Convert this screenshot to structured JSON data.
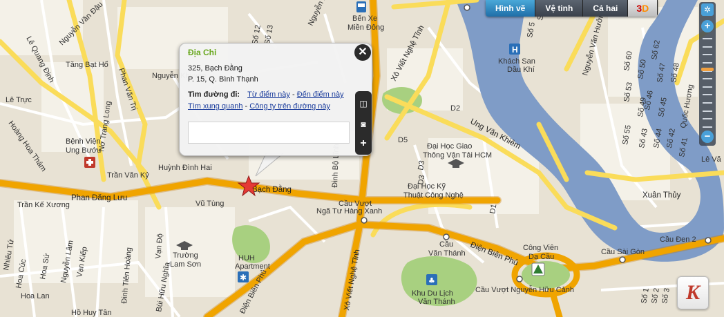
{
  "map_type_tabs": [
    {
      "label": "Hình vẽ",
      "active": true
    },
    {
      "label": "Vệ tinh",
      "active": false
    },
    {
      "label": "Cả hai",
      "active": false
    }
  ],
  "tab_3d": {
    "label_3": "3",
    "label_d": "D"
  },
  "zoom": {
    "plus": "+",
    "minus": "−",
    "level_fraction": 0.35
  },
  "popup": {
    "title": "Địa Chỉ",
    "address_line1": "325, Bạch Đằng",
    "address_line2": "P. 15, Q. Bình Thạnh",
    "directions_label": "Tìm đường đi:",
    "from_here": "Từ điểm này",
    "to_here": "Đến điểm này",
    "nearby": "Tìm xung quanh",
    "companies": "Công ty trên đường này",
    "separator": " - ",
    "close_label": "✕"
  },
  "side_tools": {
    "zoom_in": "+"
  },
  "labels": {
    "nguyen_xi": "Nguyễn Xí",
    "ben_xe_1": "Bến Xe",
    "ben_xe_2": "Miền Đông",
    "xo_viet_nghe_tinh_top": "Xô Viết Nghệ Tĩnh",
    "xo_viet_nghe_tinh_bottom": "Xô Viết Nghệ Tĩnh",
    "khach_san_1": "Khách San",
    "khach_san_2": "Dầu Khí",
    "nguyen_van_huong": "Nguyễn Văn Hưởng",
    "le_quang_dinh": "Lê Quang Định",
    "nguyen_van_dau": "Nguyễn Văn Đậu",
    "tang_bat_ho": "Tăng Bạt Hổ",
    "no_trang_long": "Nơ Trang Long",
    "phan_van_tri": "Phan Văn Trị",
    "nguyen_khuyen": "Nguyễn Khuyến",
    "le_truc": "Lê Trực",
    "hoang_hoa_tham": "Hoàng Hoa Thám",
    "benh_vien_1": "Bệnh Viện",
    "benh_vien_2": "Ung Bướu",
    "tran_van_ky": "Trần Văn Kỷ",
    "huynh_dinh_hai": "Huỳnh Đình Hai",
    "bach_dang": "Bạch Đằng",
    "dinh_bo_linh": "Đinh Bộ Lĩnh",
    "phan_dang_luu": "Phan Đăng Lưu",
    "tran_ke_xuong": "Trần Kế Xương",
    "vu_tung": "Vũ Tùng",
    "cau_vuot_1": "Cầu Vượt",
    "cau_vuot_2": "Ngã Tư Hàng Xanh",
    "ung_van_khiem": "Ung Văn Khiêm",
    "dh_gtvt_1": "Đại Học Giao",
    "dh_gtvt_2": "Thông Vận Tải HCM",
    "dh_ktcn_1": "Đại Học Kỹ",
    "dh_ktcn_2": "Thuật Công Nghệ",
    "xuan_thuy": "Xuân Thủy",
    "d2": "D2",
    "d5": "D5",
    "d3": "D3",
    "d1": "D1",
    "d3b": "D3",
    "cau_sai_gon": "Cầu Sài Gòn",
    "cau_den_2": "Cầu Đen 2",
    "dien_bien_phu_right": "Điện Biên Phủ",
    "dien_bien_phu_left": "Điện Biên Phủ",
    "cong_vien_1": "Công Viên",
    "cong_vien_2": "Dạ Cầu",
    "cau_van_thanh_1": "Cầu",
    "cau_van_thanh_2": "Văn Thánh",
    "khu_du_lich_1": "Khu Du Lịch",
    "khu_du_lich_2": "Văn Thánh",
    "cau_vuot_nhc": "Cầu Vượt Nguyễn Hữu Cảnh",
    "huh_1": "HUH",
    "huh_2": "Apartment",
    "truong_1": "Trường",
    "truong_2": "Lam Sơn",
    "nguyen_lam": "Nguyễn Lâm",
    "van_kiep": "Vạn Kiếp",
    "hoa_su": "Hoa Sứ",
    "hoa_cuc": "Hoa Cúc",
    "hoa_lan": "Hoa Lan",
    "nhieu_tu": "Nhiêu Tứ",
    "dinh_tien_hoang": "Đinh Tiên Hoàng",
    "vo_do": "Vạn Độ",
    "bui_huu_nghia": "Bùi Hữu Nghĩa",
    "phu_huy_tan": "Hồ Huy Tân",
    "quoc_huong": "Quốc Hương",
    "le_van": "Lê Vă",
    "so_5": "Số 5",
    "so_6": "Số 6",
    "so_60": "Số 60",
    "so_62": "Số 62",
    "so_47": "Số 47",
    "so_46": "Số 46",
    "so_45": "Số 45",
    "so_48": "Số 48",
    "so_44": "Số 44",
    "so_42": "Số 42",
    "so_55": "Số 55",
    "so_53": "Số 53",
    "so_50": "Số 50",
    "so_49": "Số 49",
    "so_43": "Số 43",
    "so_41": "Số 41",
    "so_12": "Số 12",
    "so_13": "Số 13",
    "so_3": "Số 3",
    "so_2": "Số 2",
    "so_1": "Số 1"
  },
  "logo_letter": "K",
  "colors": {
    "land": "#e8e2d4",
    "block": "#f5f2ea",
    "major_road": "#f0a400",
    "secondary_road": "#fadc5a",
    "minor_road": "#ffffff",
    "water": "#7f9cc7",
    "park": "#a8d080",
    "accent": "#2a8ad0"
  }
}
